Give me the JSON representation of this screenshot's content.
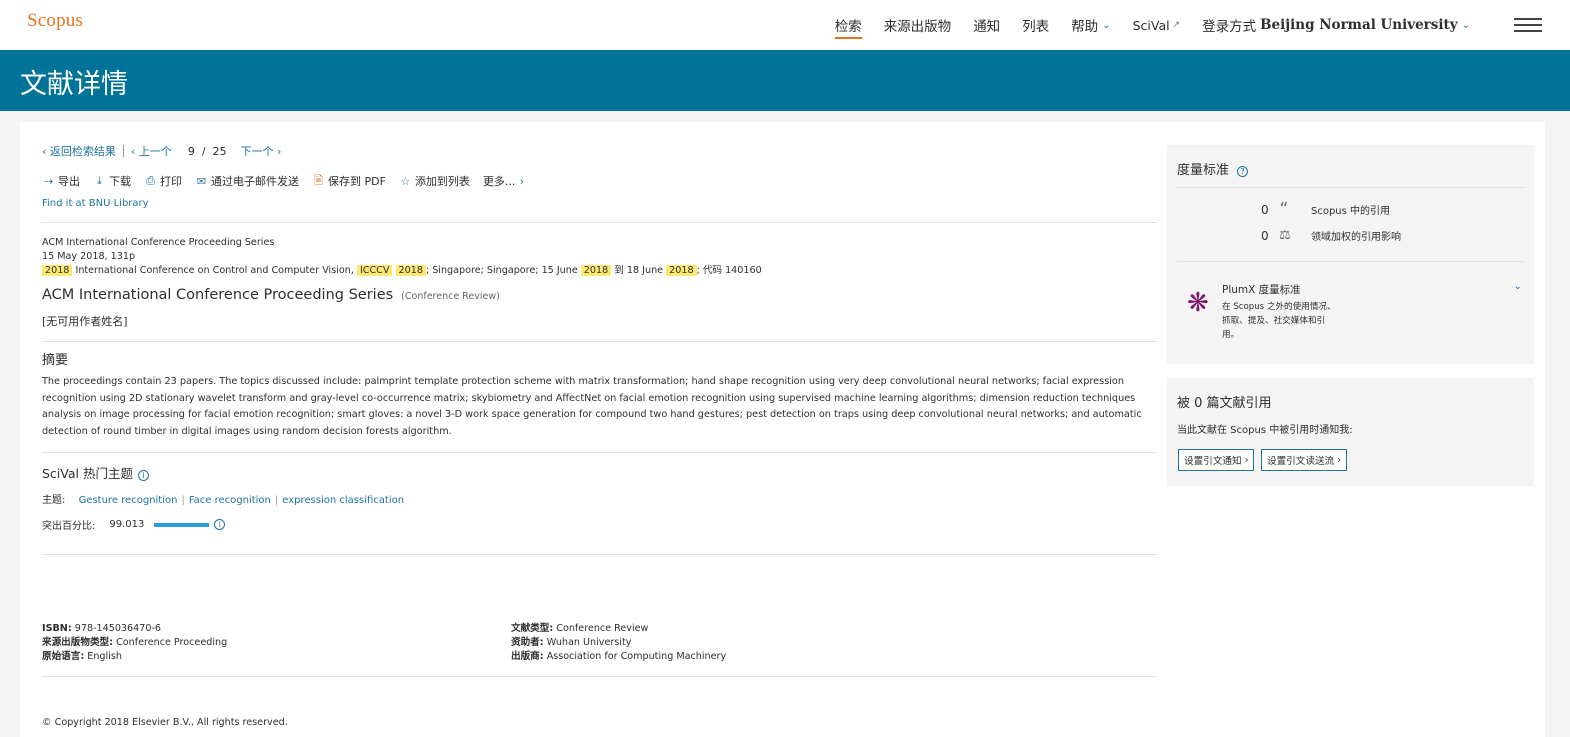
{
  "app": {
    "name": "Scopus"
  },
  "nav": {
    "items": [
      "检索",
      "来源出版物",
      "通知",
      "列表"
    ],
    "help": "帮助",
    "scival": "SciVal",
    "login_prefix": "登录方式",
    "login_institution": "Beijing Normal University"
  },
  "banner": {
    "title": "文献详情"
  },
  "pager": {
    "back": "返回检索结果",
    "prev": "上一个",
    "current": "9",
    "divider": "/",
    "total": "25",
    "next": "下一个"
  },
  "tools": {
    "export": "导出",
    "download": "下载",
    "print": "打印",
    "email": "通过电子邮件发送",
    "pdf": "保存到 PDF",
    "add_list": "添加到列表",
    "more": "更多..."
  },
  "find_it": "Find it at BNU Library",
  "meta": {
    "series": "ACM International Conference Proceeding Series",
    "date_pages": "15 May 2018, 131p",
    "line3": {
      "y1": "2018",
      "t1": "International Conference on Control and Computer Vision,",
      "abbr": "ICCCV",
      "y2": "2018",
      "t2": "; Singapore; Singapore; 15 June",
      "y3": "2018",
      "t3": "到 18 June",
      "y4": "2018",
      "t4": "; 代码 140160"
    }
  },
  "document": {
    "title": "ACM International Conference Proceeding Series",
    "type_tag": "(Conference Review)",
    "authors": "[无可用作者姓名]"
  },
  "abstract": {
    "heading": "摘要",
    "text": "The proceedings contain 23 papers. The topics discussed include: palmprint template protection scheme with matrix transformation; hand shape recognition using very deep convolutional neural networks; facial expression recognition using 2D stationary wavelet transform and gray-level co-occurrence matrix; skybiometry and AffectNet on facial emotion recognition using supervised machine learning algorithms; dimension reduction techniques analysis on image processing for facial emotion recognition; smart gloves: a novel 3-D work space generation for compound two hand gestures; pest detection on traps using deep convolutional neural networks; and automatic detection of round timber in digital images using random decision forests algorithm."
  },
  "scival": {
    "heading": "SciVal 热门主题",
    "topics_label": "主题:",
    "topics": [
      "Gesture recognition",
      "Face recognition",
      "expression classification"
    ],
    "prominence_label": "突出百分比:",
    "prominence_value": "99.013",
    "prominence_fraction": 0.99
  },
  "details": {
    "isbn_label": "ISBN:",
    "isbn": "978-145036470-6",
    "source_type_label": "来源出版物类型:",
    "source_type": "Conference Proceeding",
    "language_label": "原始语言:",
    "language": "English",
    "doc_type_label": "文献类型:",
    "doc_type": "Conference Review",
    "sponsor_label": "资助者:",
    "sponsor": "Wuhan University",
    "publisher_label": "出版商:",
    "publisher": "Association for Computing Machinery"
  },
  "copyright": "© Copyright 2018 Elsevier B.V., All rights reserved.",
  "metrics": {
    "heading": "度量标准",
    "citations_count": "0",
    "citations_label": "Scopus 中的引用",
    "fwci_count": "0",
    "fwci_label": "领域加权的引用影响",
    "plumx_title": "PlumX 度量标准",
    "plumx_desc": "在 Scopus 之外的使用情况、抓取、提及、社交媒体和引用。"
  },
  "cited_by": {
    "heading": "被 0 篇文献引用",
    "notify_text": "当此文献在 Scopus 中被引用时通知我:",
    "btn_alert": "设置引文通知",
    "btn_feed": "设置引文读送流"
  },
  "colors": {
    "brand": "#e9711c",
    "banner": "#007398",
    "link": "#2073a0",
    "highlight": "#ffe872",
    "plumx": "#7d1a6c"
  }
}
